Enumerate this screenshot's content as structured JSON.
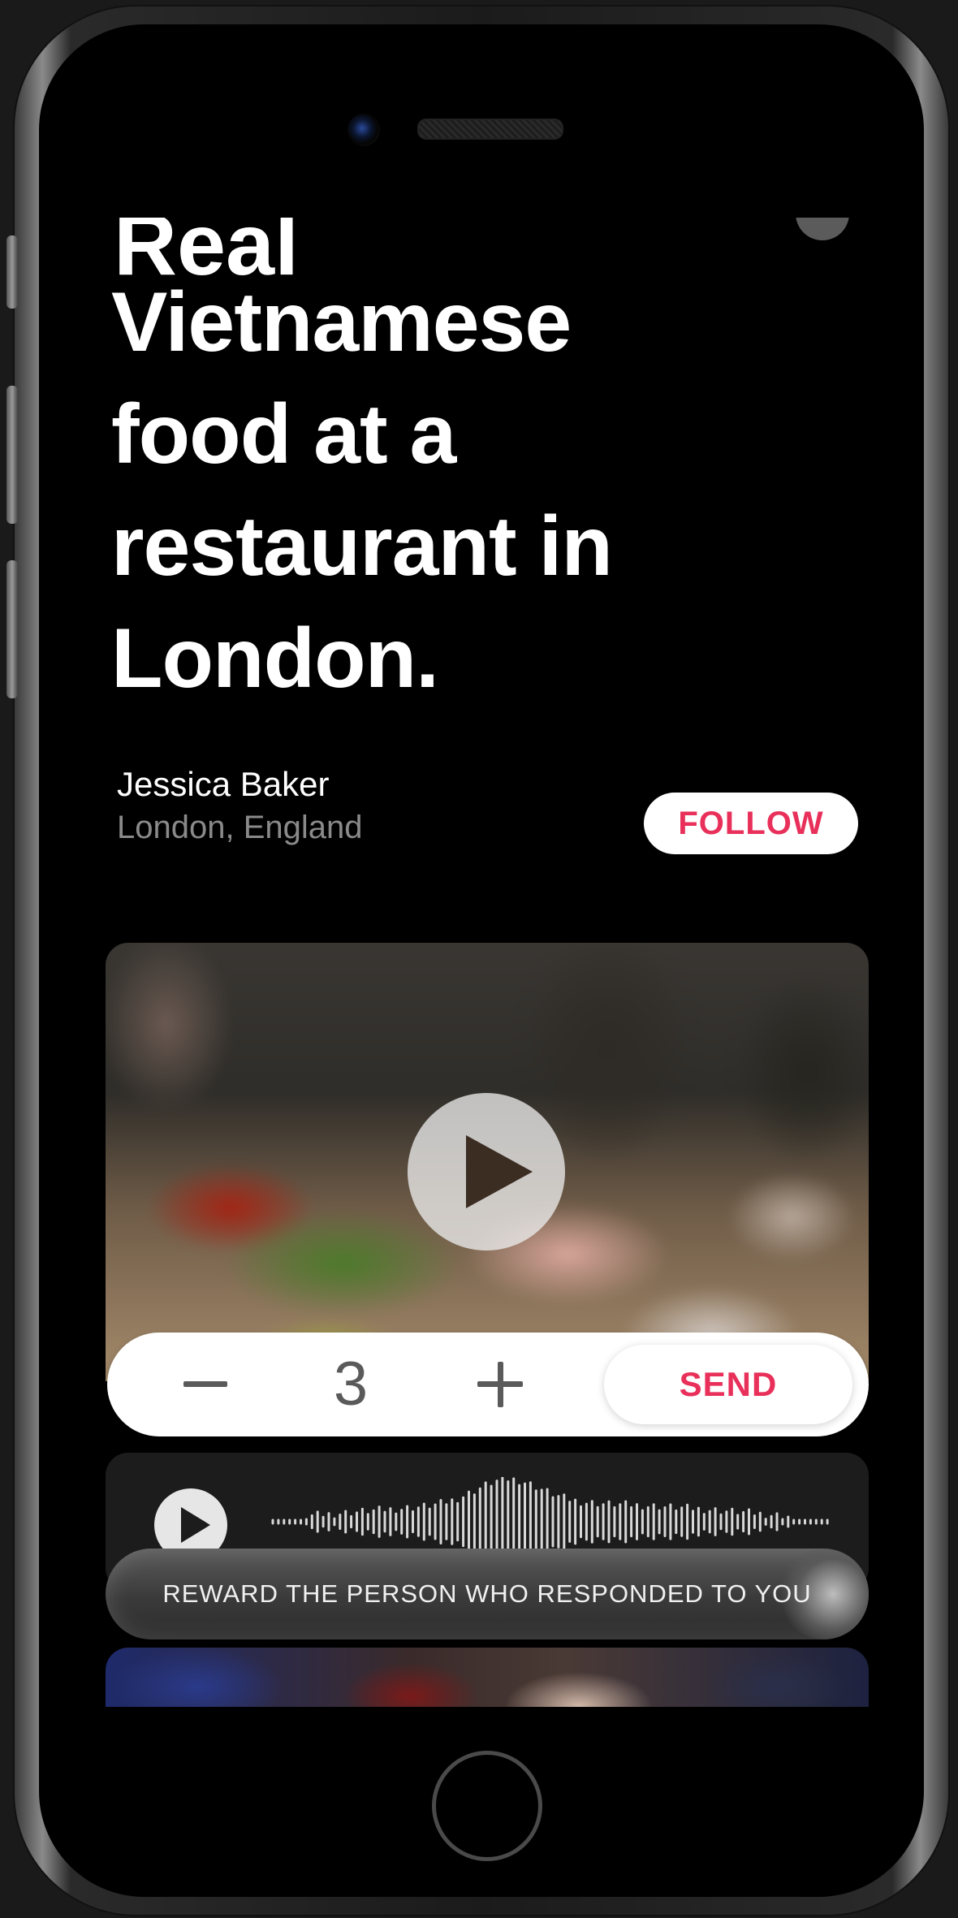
{
  "post": {
    "clipped_title": "Real",
    "headline": "Vietnamese food at a restaurant in London.",
    "author": {
      "name": "Jessica Baker",
      "location": "London, England"
    },
    "follow_label": "FOLLOW"
  },
  "reward": {
    "count": "3",
    "send_label": "SEND",
    "tooltip": "REWARD THE PERSON WHO RESPONDED TO YOU"
  },
  "colors": {
    "accent": "#e8305a",
    "background": "#000000",
    "secondary_text": "#8a8a8a"
  },
  "icons": {
    "video_play": "play-icon",
    "audio_play": "play-icon",
    "decrement": "minus-icon",
    "increment": "plus-icon"
  }
}
